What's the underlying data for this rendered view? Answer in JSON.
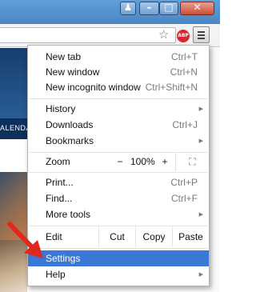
{
  "window": {
    "user_glyph": "♟",
    "minimize_glyph": "–",
    "maximize_glyph": "□",
    "close_glyph": "✕"
  },
  "toolbar": {
    "star_icon": "bookmark-star-icon",
    "abp_label": "ABP",
    "menu_icon": "hamburger-menu-icon"
  },
  "page": {
    "nav_text": "ALENDA"
  },
  "menu": {
    "new_tab": {
      "label": "New tab",
      "shortcut": "Ctrl+T"
    },
    "new_window": {
      "label": "New window",
      "shortcut": "Ctrl+N"
    },
    "new_incognito": {
      "label": "New incognito window",
      "shortcut": "Ctrl+Shift+N"
    },
    "history": {
      "label": "History"
    },
    "downloads": {
      "label": "Downloads",
      "shortcut": "Ctrl+J"
    },
    "bookmarks": {
      "label": "Bookmarks"
    },
    "zoom": {
      "label": "Zoom",
      "minus": "−",
      "level": "100%",
      "plus": "+",
      "fullscreen": "⛶"
    },
    "print": {
      "label": "Print...",
      "shortcut": "Ctrl+P"
    },
    "find": {
      "label": "Find...",
      "shortcut": "Ctrl+F"
    },
    "more_tools": {
      "label": "More tools"
    },
    "edit": {
      "label": "Edit",
      "cut": "Cut",
      "copy": "Copy",
      "paste": "Paste"
    },
    "settings": {
      "label": "Settings"
    },
    "help": {
      "label": "Help"
    },
    "submenu_arrow": "▶"
  },
  "colors": {
    "highlight": "#3a78d6",
    "arrow": "#e0281f"
  }
}
